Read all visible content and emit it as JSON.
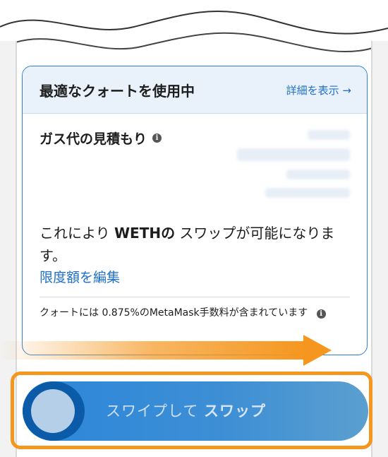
{
  "card": {
    "title": "最適なクォートを使用中",
    "details_link": "詳細を表示 →"
  },
  "gas": {
    "label": "ガス代の見積もり",
    "info_icon": "info-icon"
  },
  "approval": {
    "prefix": "これにより ",
    "token": "WETHの",
    "suffix": " スワップが可能になります。",
    "edit_limit": "限度額を編集"
  },
  "fee_note": {
    "text": "クォートには 0.875%のMetaMask手数料が含まれています"
  },
  "swipe": {
    "label_prefix": "スワイプして ",
    "label_bold": "スワップ"
  },
  "colors": {
    "accent_blue": "#2f7fd0",
    "highlight_orange": "#f5961e",
    "knob_dark": "#0b5ba8"
  }
}
